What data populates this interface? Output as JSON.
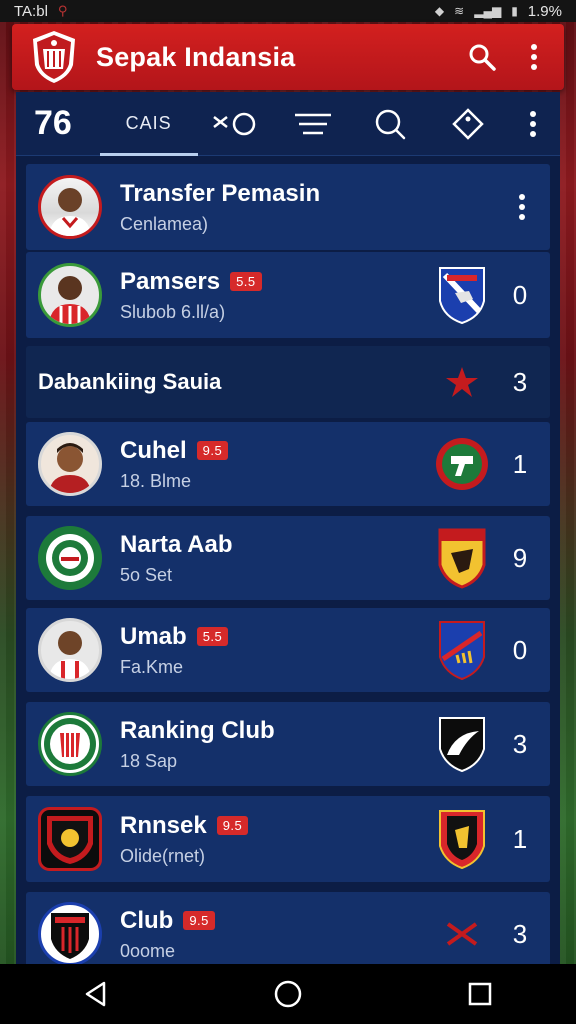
{
  "status_bar": {
    "left_text": "TA:bl",
    "right_text": "1.9%"
  },
  "app_bar": {
    "title": "Sepak Indansia"
  },
  "tabs": {
    "count": "76",
    "active_label": "CAIS"
  },
  "colors": {
    "brand_red": "#c81b1e",
    "panel_navy": "#14306a",
    "badge_red": "#d62a2a"
  },
  "list": {
    "header": {
      "title": "Transfer Pemasin",
      "subtitle": "Cenlamea)"
    },
    "items_top": {
      "title": "Pamsers",
      "badge": "5.5",
      "subtitle": "Slubob 6.ll/a)",
      "value": "0"
    },
    "section": {
      "title": "Dabankiing Sauia",
      "value": "3"
    },
    "items": [
      {
        "title": "Cuhel",
        "badge": "9.5",
        "subtitle": "18. Blme",
        "value": "1"
      },
      {
        "title": "Narta Aab",
        "badge": "",
        "subtitle": "5o Set",
        "value": "9"
      },
      {
        "title": "Umab",
        "badge": "5.5",
        "subtitle": "Fa.Kme",
        "value": "0"
      },
      {
        "title": "Ranking Club",
        "badge": "",
        "subtitle": "18 Sap",
        "value": "3"
      },
      {
        "title": "Rnnsek",
        "badge": "9.5",
        "subtitle": "Olide(rnet)",
        "value": "1"
      },
      {
        "title": "Club",
        "badge": "9.5",
        "subtitle": "0oome",
        "value": "3"
      }
    ]
  }
}
